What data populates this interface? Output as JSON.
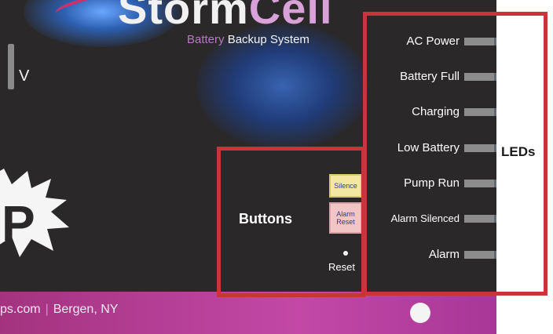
{
  "header": {
    "logo_text": "StormCell",
    "logo_main": "Storm",
    "logo_accent": "Cell",
    "subtitle_brand": "Battery",
    "subtitle_rest": "Backup System"
  },
  "left": {
    "voltage_label": "V",
    "letter": "P"
  },
  "leds": {
    "group_label": "LEDs",
    "items": [
      {
        "label": "AC Power"
      },
      {
        "label": "Battery Full"
      },
      {
        "label": "Charging"
      },
      {
        "label": "Low Battery"
      },
      {
        "label": "Pump Run"
      },
      {
        "label": "Alarm Silenced"
      },
      {
        "label": "Alarm"
      }
    ]
  },
  "buttons": {
    "group_label": "Buttons",
    "silence": "Silence",
    "alarm_reset_line1": "Alarm",
    "alarm_reset_line2": "Reset",
    "reset": "Reset"
  },
  "footer": {
    "website": "ps.com",
    "location": "Bergen, NY"
  },
  "colors": {
    "panel": "#2a2829",
    "callout_border": "#c9343a",
    "footer": "#b83e98",
    "led_bar": "#8c8c8c"
  }
}
